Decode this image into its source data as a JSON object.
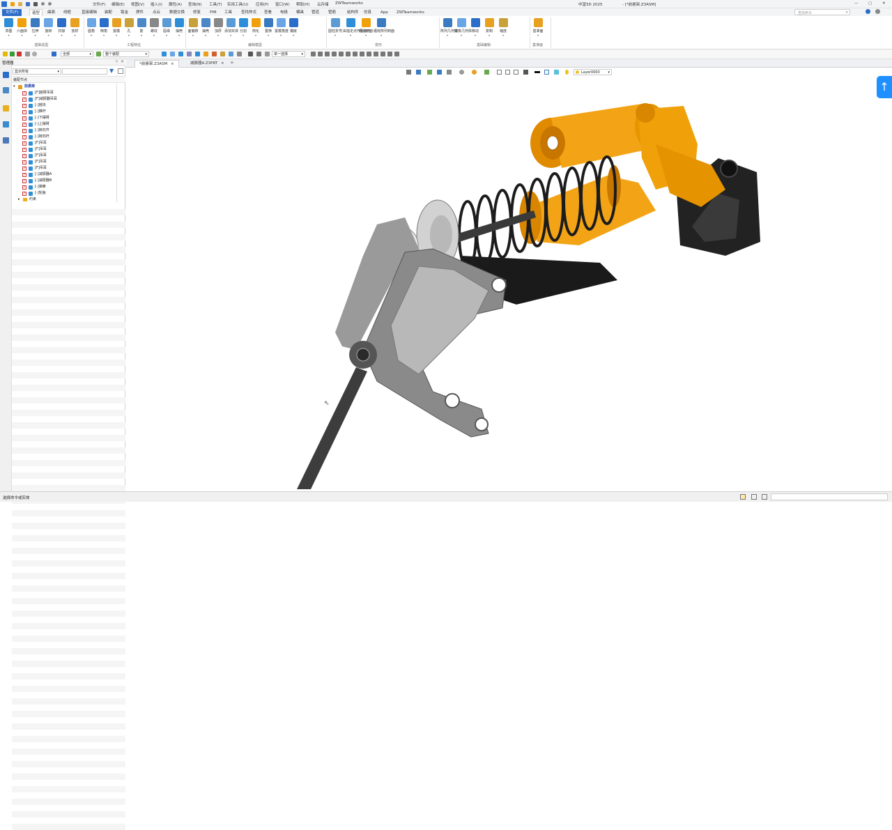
{
  "app": {
    "product": "中望3D 2025",
    "window_title": "- [*前悬架.Z3ASM]",
    "search_placeholder": "查找命令"
  },
  "menubar": [
    "文件(F)",
    "编辑(E)",
    "视图(V)",
    "插入(I)",
    "属性(A)",
    "查询(N)",
    "工具(T)",
    "实用工具(U)",
    "应用(P)",
    "窗口(W)",
    "帮助(H)",
    "云存储",
    "ZWTeamworks"
  ],
  "ribbon_tabs": [
    "文件(F)",
    "造型",
    "曲面",
    "线框",
    "直接编辑",
    "装配",
    "钣金",
    "焊件",
    "点云",
    "数据交换",
    "修复",
    "PMI",
    "工具",
    "查找样式",
    "查看",
    "电极",
    "模具",
    "管道",
    "管筋",
    "结构件",
    "仿真",
    "App",
    "ZWTeamworks"
  ],
  "ribbon": {
    "groups": [
      {
        "label": "基础造型",
        "buttons": [
          "草图",
          "六面体",
          "拉伸",
          "旋转",
          "扫掠",
          "放样"
        ]
      },
      {
        "label": "工程特征",
        "buttons": [
          "圆角",
          "倒角",
          "拔模",
          "孔",
          "筋",
          "螺纹",
          "唇缘",
          "抽壳"
        ]
      },
      {
        "label": "编辑模型",
        "buttons": [
          "面偏移",
          "抽壳",
          "加厚",
          "添加实体",
          "分割",
          "简化",
          "置换",
          "拔模角度",
          "镶嵌"
        ]
      },
      {
        "label": "变形",
        "buttons": [
          "圆柱折弯",
          "由指定点开始变形",
          "缠绕到面",
          "缠绕阵列到面"
        ]
      },
      {
        "label": "基础编辑",
        "buttons": [
          "阵列几何体",
          "镜像几何体",
          "移动",
          "复制",
          "缩放"
        ]
      },
      {
        "label": "基准面",
        "buttons": [
          "基准面"
        ]
      }
    ]
  },
  "toolbar2": {
    "filter": "全部",
    "assembly": "整个装配",
    "selection": "单一选择"
  },
  "manager": {
    "title": "管理器",
    "filter_dropdown": "显示所有",
    "header": "装配节点",
    "root": "前悬架",
    "items": [
      "[F]摇臂吊耳",
      "[F]减振器吊耳",
      "[-]摇块",
      "[-]推杆",
      "[-]下摆臂",
      "[-]上摆臂",
      "[-]转向节",
      "[-]转向杆",
      "[F]吊耳",
      "[F]吊耳",
      "[F]吊耳",
      "[F]吊耳",
      "[F]吊耳",
      "[-]减振器A",
      "[-]减振器B",
      "[-]弹簧",
      "[-]轮胎"
    ],
    "constraints": "约束"
  },
  "doc_tabs": [
    {
      "label": "*前悬架.Z3ASM",
      "active": true
    },
    {
      "label": "减振器A.Z3PRT",
      "active": false
    }
  ],
  "view_toolbar": {
    "layer": "Layer0000"
  },
  "status": {
    "message": "选择命令或实体"
  },
  "colors": {
    "accent": "#2b6dc9",
    "orange": "#f0a10a",
    "dark": "#2a2a2a",
    "grey": "#8a8a8a"
  }
}
